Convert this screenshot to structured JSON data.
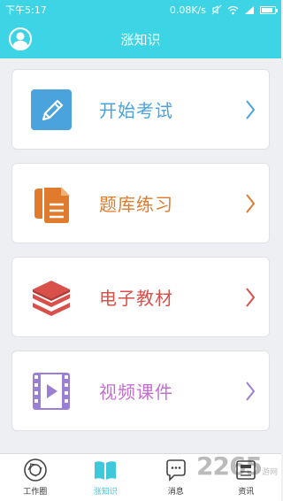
{
  "status_bar": {
    "time": "下午5:17",
    "network_speed": "0.08K/s"
  },
  "header": {
    "title": "涨知识"
  },
  "menu": [
    {
      "label": "开始考试",
      "icon": "pencil-edit-icon",
      "color": "#4aa3dc"
    },
    {
      "label": "题库练习",
      "icon": "documents-icon",
      "color": "#e07b2e"
    },
    {
      "label": "电子教材",
      "icon": "layered-books-icon",
      "color": "#d9504a"
    },
    {
      "label": "视频课件",
      "icon": "film-play-icon",
      "color": "#c36fcf"
    }
  ],
  "bottom_nav": [
    {
      "label": "工作圈",
      "icon": "aperture-circle-icon"
    },
    {
      "label": "涨知识",
      "icon": "open-book-icon",
      "active": true
    },
    {
      "label": "消息",
      "icon": "chat-bubble-icon"
    },
    {
      "label": "资讯",
      "icon": "news-icon"
    }
  ],
  "watermark": {
    "text": "2265",
    "sub": "游网"
  },
  "colors": {
    "accent": "#3dd4e6",
    "background": "#eeeff2"
  }
}
